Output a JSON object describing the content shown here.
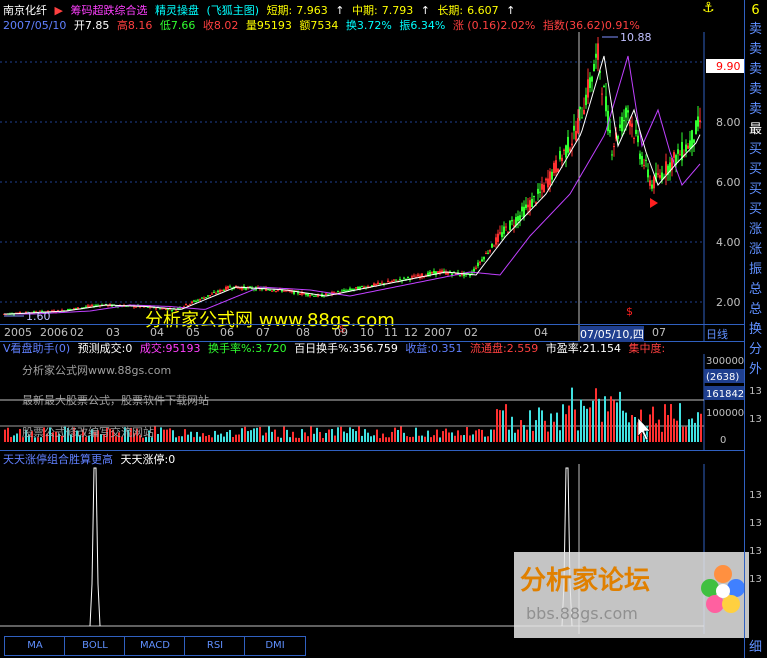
{
  "header": {
    "stock_name": "南京化纤",
    "indicator_name": "筹码超跌综合选",
    "indicator2": "精灵操盘",
    "indicator2_sub": "(飞狐主图)",
    "short_label": "短期:",
    "short_value": "7.963",
    "mid_label": "中期:",
    "mid_value": "7.793",
    "long_label": "长期:",
    "long_value": "6.607"
  },
  "quote": {
    "date": "2007/05/10",
    "open": "开7.85",
    "high": "高8.16",
    "low": "低7.66",
    "close": "收8.02",
    "volume": "量95193",
    "amount": "额7534",
    "turnover": "换3.72%",
    "amplitude": "振6.34%",
    "change": "涨 (0.16)2.02%",
    "index": "指数(36.62)0.91%"
  },
  "price_axis": {
    "ticks": [
      "8.00",
      "6.00",
      "4.00",
      "2.00"
    ],
    "current_price": "9.90"
  },
  "annotations": {
    "high_label": "10.88",
    "low_label": "1.60",
    "dollar_sign": "$"
  },
  "time_axis": {
    "labels": [
      "2005",
      "2006",
      "02",
      "03",
      "04",
      "05",
      "06",
      "07",
      "08",
      "09",
      "10",
      "11",
      "12",
      "2007",
      "02",
      "04"
    ],
    "cursor_date": "07/05/10,四",
    "after_cursor": "07",
    "period": "日线"
  },
  "watermark_main": "分析家公式网 www.88gs.com",
  "volume_panel": {
    "title": "V看盘助手(0)",
    "predict": "预测成交:0",
    "volume": "成交:95193",
    "turnover_rate": "换手率%:3.720",
    "hundred_day": "百日换手%:356.759",
    "profit": "收益:0.351",
    "float_shares": "流通盘:2.559",
    "pe_ratio": "市盈率:21.154",
    "concentration": "集中度:",
    "ticks": [
      "300000",
      "(2638)",
      "161842",
      "100000",
      "0"
    ],
    "text1": "分析家公式网www.88gs.com",
    "text2": "最新最大股票公式，股票软件下载网站",
    "text3": "股票公式修改编写交流网站"
  },
  "indicator_panel": {
    "title": "天天涨停组合胜算更高",
    "label": "天天涨停:0"
  },
  "tabs": [
    "MA",
    "BOLL",
    "MACD",
    "RSI",
    "DMI"
  ],
  "right_panel": {
    "items": [
      "6",
      "卖",
      "卖",
      "卖",
      "卖",
      "卖",
      "最",
      "买",
      "买",
      "买",
      "买",
      "涨",
      "涨",
      "振",
      "总",
      "总",
      "换",
      "分",
      "外"
    ],
    "side_numbers": [
      "13",
      "13",
      "13",
      "13",
      "13",
      "13"
    ],
    "bottom": "细"
  },
  "forum_watermark": {
    "title": "分析家论坛",
    "url": "bbs.88gs.com"
  },
  "colors": {
    "up": "#ff3030",
    "down": "#30ff30",
    "ma_white": "#ffffff",
    "ma_magenta": "#c040ff",
    "axis": "#3060c0"
  }
}
